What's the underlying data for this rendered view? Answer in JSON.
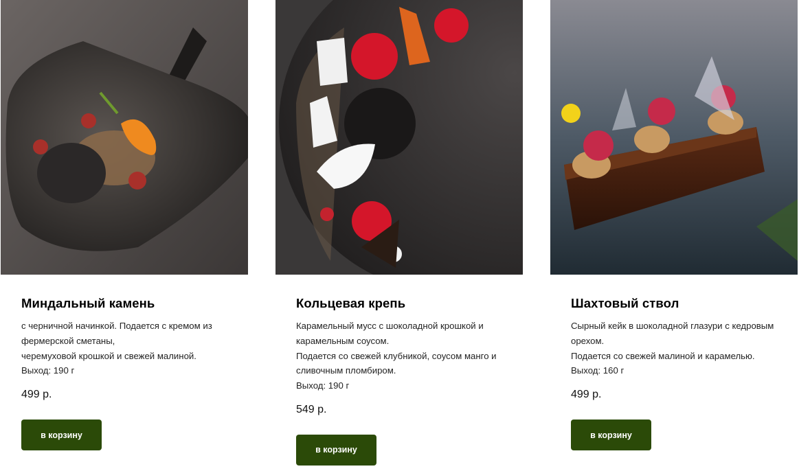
{
  "products": [
    {
      "name": "Миндальный камень",
      "description": [
        "с черничной начинкой. Подается с кремом из",
        "фермерской сметаны,",
        "черемуховой крошкой и свежей малиной.",
        "Выход: 190 г"
      ],
      "price": "499 р.",
      "button_label": "в корзину"
    },
    {
      "name": "Кольцевая крепь",
      "description": [
        "Карамельный мусс с шоколадной крошкой и",
        "карамельным соусом.",
        "Подается со свежей клубникой, соусом манго и",
        "сливочным пломбиром.",
        "Выход: 190 г"
      ],
      "price": "549 р.",
      "button_label": "в корзину"
    },
    {
      "name": "Шахтовый ствол",
      "description": [
        "Сырный кейк в шоколадной глазури с кедровым",
        "орехом.",
        "Подается со свежей малиной и карамелью.",
        "Выход: 160 г"
      ],
      "price": "499 р.",
      "button_label": "в корзину"
    }
  ],
  "colors": {
    "button_bg": "#2b4a08",
    "button_text": "#ffffff"
  }
}
